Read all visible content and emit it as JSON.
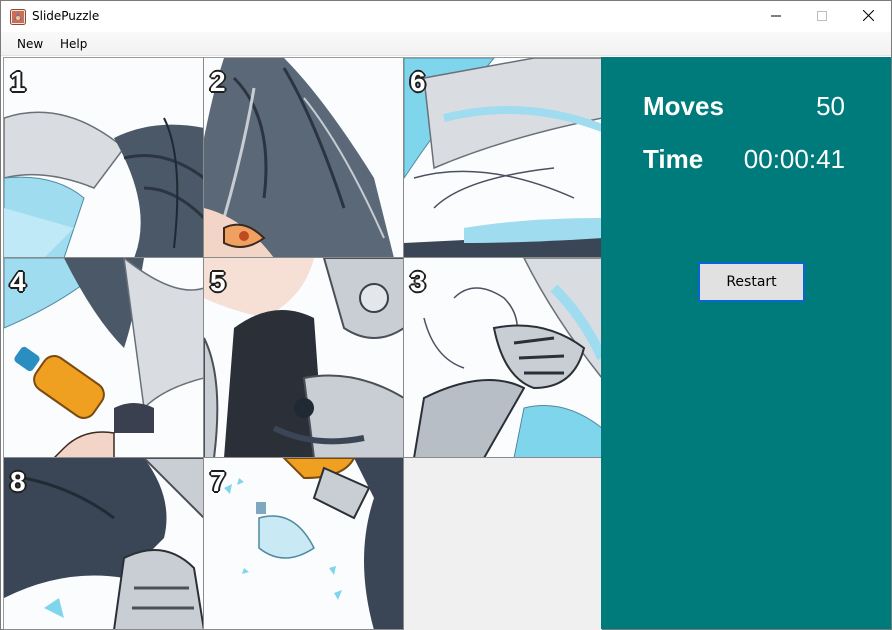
{
  "window": {
    "title": "SlidePuzzle"
  },
  "menu": {
    "items": [
      {
        "label": "New"
      },
      {
        "label": "Help"
      }
    ]
  },
  "board": {
    "grid": "3x3",
    "tiles": [
      {
        "slot": 1,
        "number": "1"
      },
      {
        "slot": 2,
        "number": "2"
      },
      {
        "slot": 3,
        "number": "6"
      },
      {
        "slot": 4,
        "number": "4"
      },
      {
        "slot": 5,
        "number": "5"
      },
      {
        "slot": 6,
        "number": "3"
      },
      {
        "slot": 7,
        "number": "8"
      },
      {
        "slot": 8,
        "number": "7"
      }
    ],
    "empty_slot": 9
  },
  "stats": {
    "moves_label": "Moves",
    "moves_value": "50",
    "time_label": "Time",
    "time_value": "00:00:41"
  },
  "controls": {
    "restart_label": "Restart"
  },
  "colors": {
    "panel_bg": "#007b7b",
    "board_bg": "#f0f0f0",
    "accent_border": "#0a64d6",
    "wing_blue": "#7fd6ec"
  },
  "icons": {
    "app": "puzzle-app-icon",
    "minimize": "minimize-icon",
    "maximize": "maximize-icon",
    "close": "close-icon"
  }
}
